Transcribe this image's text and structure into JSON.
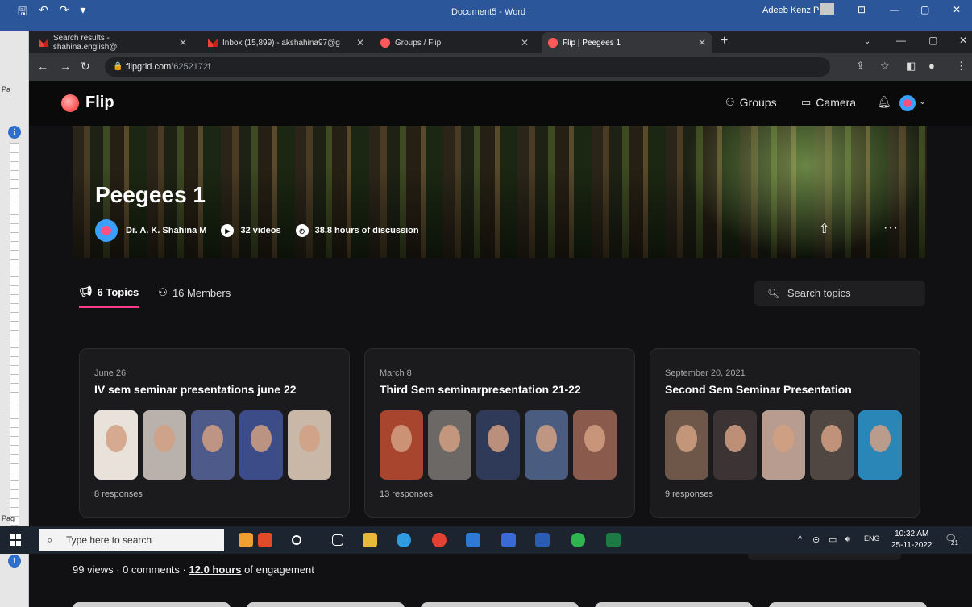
{
  "word": {
    "title": "Document5 - Word",
    "user": "Adeeb Kenz P",
    "page_label_top": "Pa",
    "page_label_bottom": "Pag"
  },
  "browser": {
    "tabs": [
      {
        "label": "Search results - shahina.english@",
        "icon": "gmail-icon"
      },
      {
        "label": "Inbox (15,899) - akshahina97@g",
        "icon": "gmail-icon"
      },
      {
        "label": "Groups / Flip",
        "icon": "flip-icon"
      },
      {
        "label": "Flip | Peegees 1",
        "icon": "flip-icon",
        "active": true
      }
    ],
    "url_host": "flipgrid.com",
    "url_path": "/6252172f"
  },
  "flip": {
    "brand": "Flip",
    "nav": {
      "groups": "Groups",
      "camera": "Camera"
    },
    "group": {
      "title": "Peegees 1",
      "owner": "Dr. A. K. Shahina M",
      "videos": "32 videos",
      "hours": "38.8 hours of discussion"
    },
    "tabs": {
      "topics": "6 Topics",
      "members": "16 Members"
    },
    "search_placeholder": "Search topics",
    "topics": [
      {
        "date": "June 26",
        "title": "IV sem seminar presentations june 22",
        "responses": "8 responses"
      },
      {
        "date": "March 8",
        "title": "Third Sem seminarpresentation 21-22",
        "responses": "13 responses"
      },
      {
        "date": "September 20, 2021",
        "title": "Second Sem Seminar Presentation",
        "responses": "9 responses"
      }
    ],
    "below": {
      "stats_prefix": "99 views · 0 comments · ",
      "stats_hours": "12.0 hours",
      "stats_suffix": " of engagement"
    }
  },
  "taskbar": {
    "search_placeholder": "Type here to search",
    "lang": "ENG",
    "time": "10:32 AM",
    "date": "25-11-2022",
    "notif_count": "21"
  },
  "colors": {
    "accent": "#ff3a8c",
    "flip_brand": "#ff5a5a",
    "word_blue": "#2b579a"
  }
}
